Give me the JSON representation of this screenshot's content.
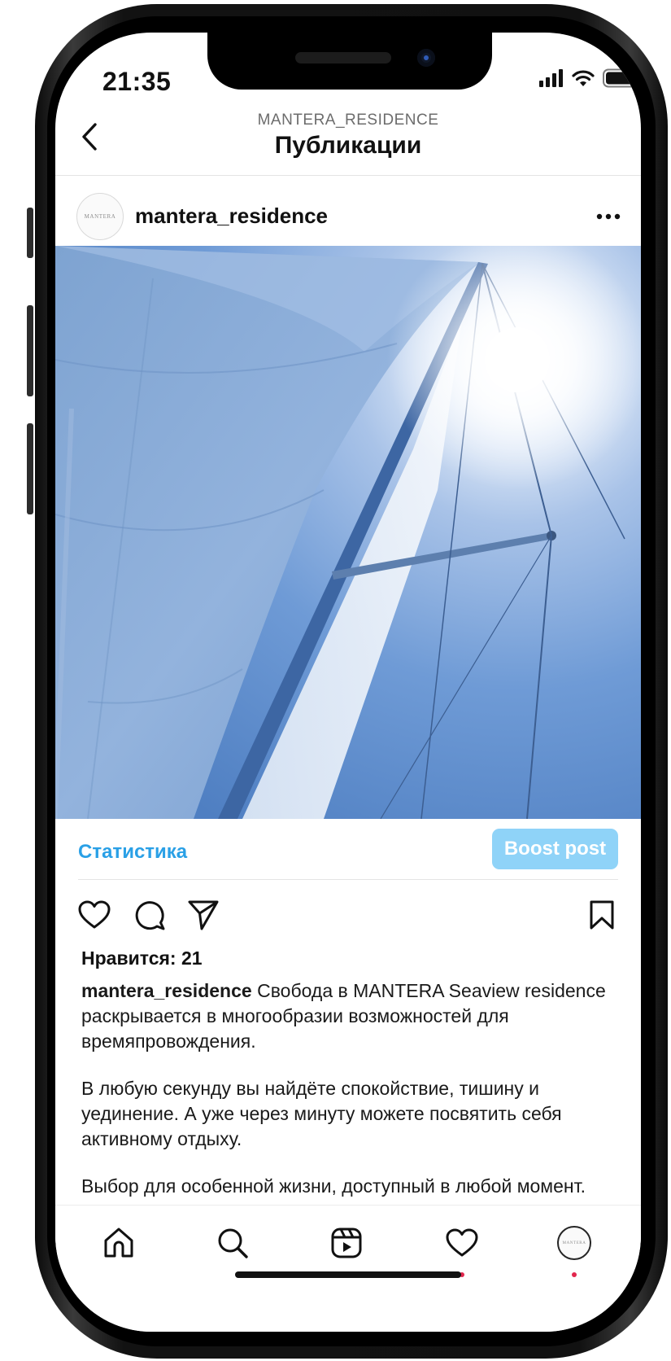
{
  "status_bar": {
    "time": "21:35",
    "icons": [
      "cellular-signal-icon",
      "wifi-icon",
      "battery-icon"
    ]
  },
  "header": {
    "account_label": "MANTERA_RESIDENCE",
    "title": "Публикации",
    "back_icon": "chevron-left-icon"
  },
  "post": {
    "username": "mantera_residence",
    "avatar_text": "MANTERA",
    "more_icon": "more-horizontal-icon",
    "image_description_icon": "sail-photo",
    "insights_label": "Статистика",
    "boost_label": "Boost post",
    "actions": [
      "heart-icon",
      "comment-icon",
      "share-icon",
      "bookmark-icon"
    ],
    "likes": "Нравится: 21",
    "caption_user": "mantera_residence",
    "caption_first": " Свобода в MANTERA Seaview residence раскрывается в многообразии возможностей для времяпровождения.",
    "caption_second": "В любую секунду вы найдёте спокойствие, тишину и уединение. А уже через минуту можете посвятить себя активному отдыху.",
    "caption_third": "Выбор для особенной жизни, доступный в любой момент."
  },
  "bottom_nav": {
    "items": [
      "home-icon",
      "search-icon",
      "reels-icon",
      "activity-heart-icon",
      "profile-avatar"
    ],
    "notification_dots": [
      "activity-heart-icon",
      "profile-avatar"
    ]
  },
  "colors": {
    "link_blue": "#2aa0e6",
    "boost_button": "#8fd3f8",
    "notification_dot": "#e2264d",
    "sky": "#5f8fd0"
  }
}
